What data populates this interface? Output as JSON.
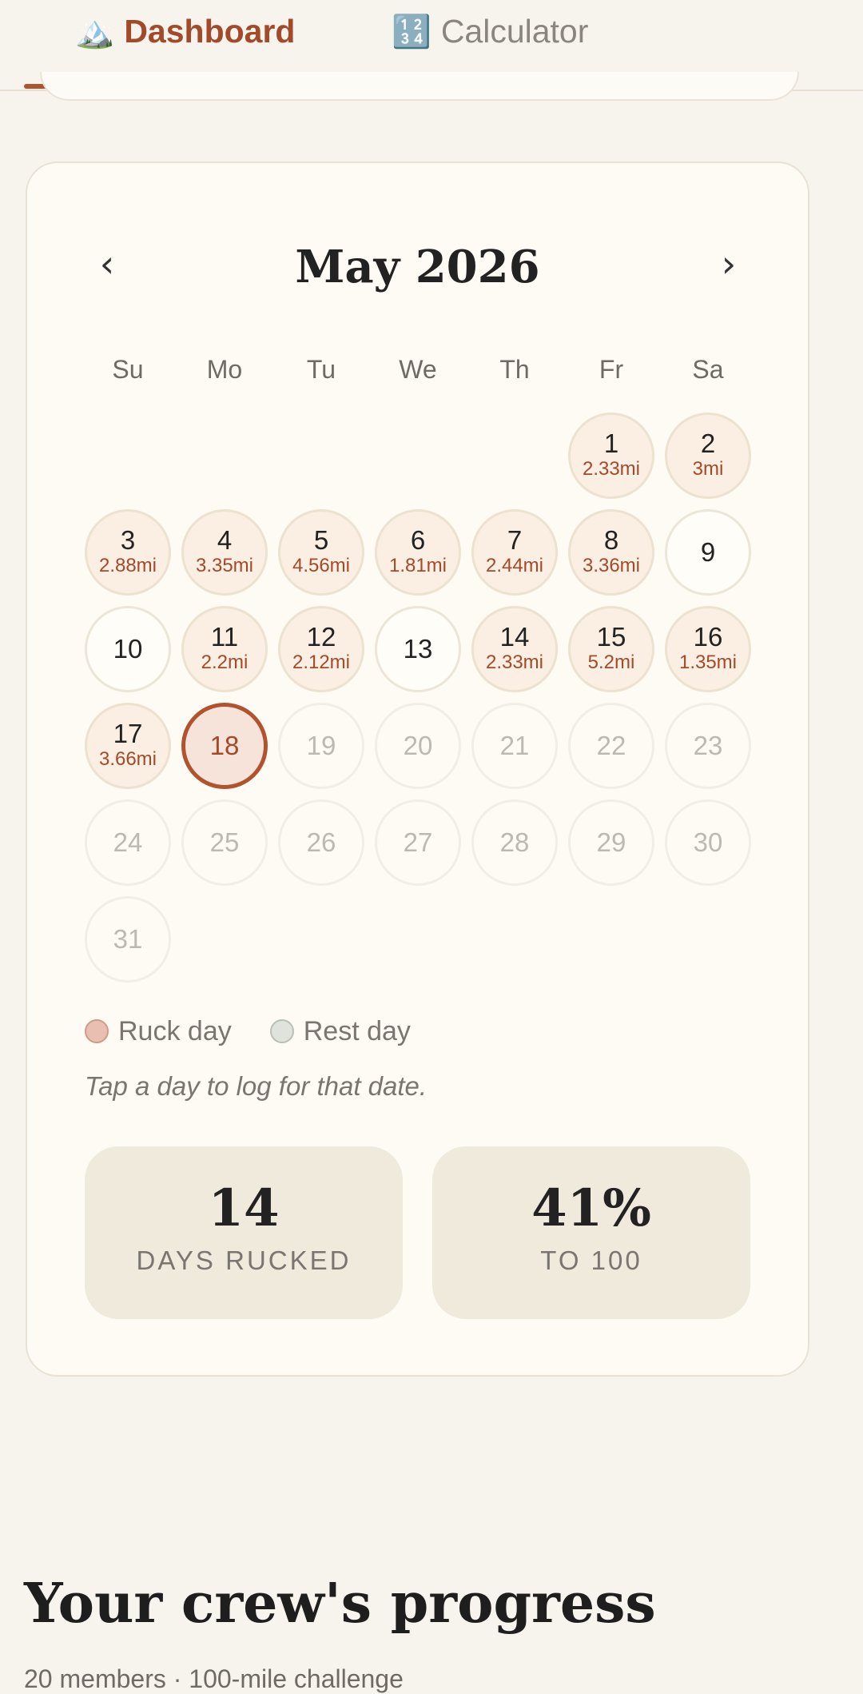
{
  "tabs": [
    {
      "icon": "🏔️",
      "label": "Dashboard"
    },
    {
      "icon": "🔢",
      "label": "Calculator"
    }
  ],
  "calendar": {
    "title": "May 2026",
    "prev": "‹",
    "next": "›",
    "weekdays": [
      "Su",
      "Mo",
      "Tu",
      "We",
      "Th",
      "Fr",
      "Sa"
    ],
    "days": [
      {
        "n": "1",
        "mi": "2.33mi"
      },
      {
        "n": "2",
        "mi": "3mi"
      },
      {
        "n": "3",
        "mi": "2.88mi"
      },
      {
        "n": "4",
        "mi": "3.35mi"
      },
      {
        "n": "5",
        "mi": "4.56mi"
      },
      {
        "n": "6",
        "mi": "1.81mi"
      },
      {
        "n": "7",
        "mi": "2.44mi"
      },
      {
        "n": "8",
        "mi": "3.36mi"
      },
      {
        "n": "9",
        "mi": ""
      },
      {
        "n": "10",
        "mi": ""
      },
      {
        "n": "11",
        "mi": "2.2mi"
      },
      {
        "n": "12",
        "mi": "2.12mi"
      },
      {
        "n": "13",
        "mi": ""
      },
      {
        "n": "14",
        "mi": "2.33mi"
      },
      {
        "n": "15",
        "mi": "5.2mi"
      },
      {
        "n": "16",
        "mi": "1.35mi"
      },
      {
        "n": "17",
        "mi": "3.66mi"
      },
      {
        "n": "18",
        "mi": ""
      },
      {
        "n": "19",
        "mi": ""
      },
      {
        "n": "20",
        "mi": ""
      },
      {
        "n": "21",
        "mi": ""
      },
      {
        "n": "22",
        "mi": ""
      },
      {
        "n": "23",
        "mi": ""
      },
      {
        "n": "24",
        "mi": ""
      },
      {
        "n": "25",
        "mi": ""
      },
      {
        "n": "26",
        "mi": ""
      },
      {
        "n": "27",
        "mi": ""
      },
      {
        "n": "28",
        "mi": ""
      },
      {
        "n": "29",
        "mi": ""
      },
      {
        "n": "30",
        "mi": ""
      },
      {
        "n": "31",
        "mi": ""
      }
    ],
    "today": "18",
    "legend": {
      "ruck": "Ruck day",
      "rest": "Rest day"
    },
    "hint": "Tap a day to log for that date."
  },
  "stats": {
    "days_value": "14",
    "days_label": "DAYS RUCKED",
    "pct_value": "41%",
    "pct_label": "TO 100"
  },
  "crew": {
    "title": "Your crew's progress",
    "subtitle": "20 members · 100-mile challenge"
  },
  "colors": {
    "accent": "#b0532e",
    "background": "#f7f4ee",
    "card": "#fdfbf4"
  }
}
